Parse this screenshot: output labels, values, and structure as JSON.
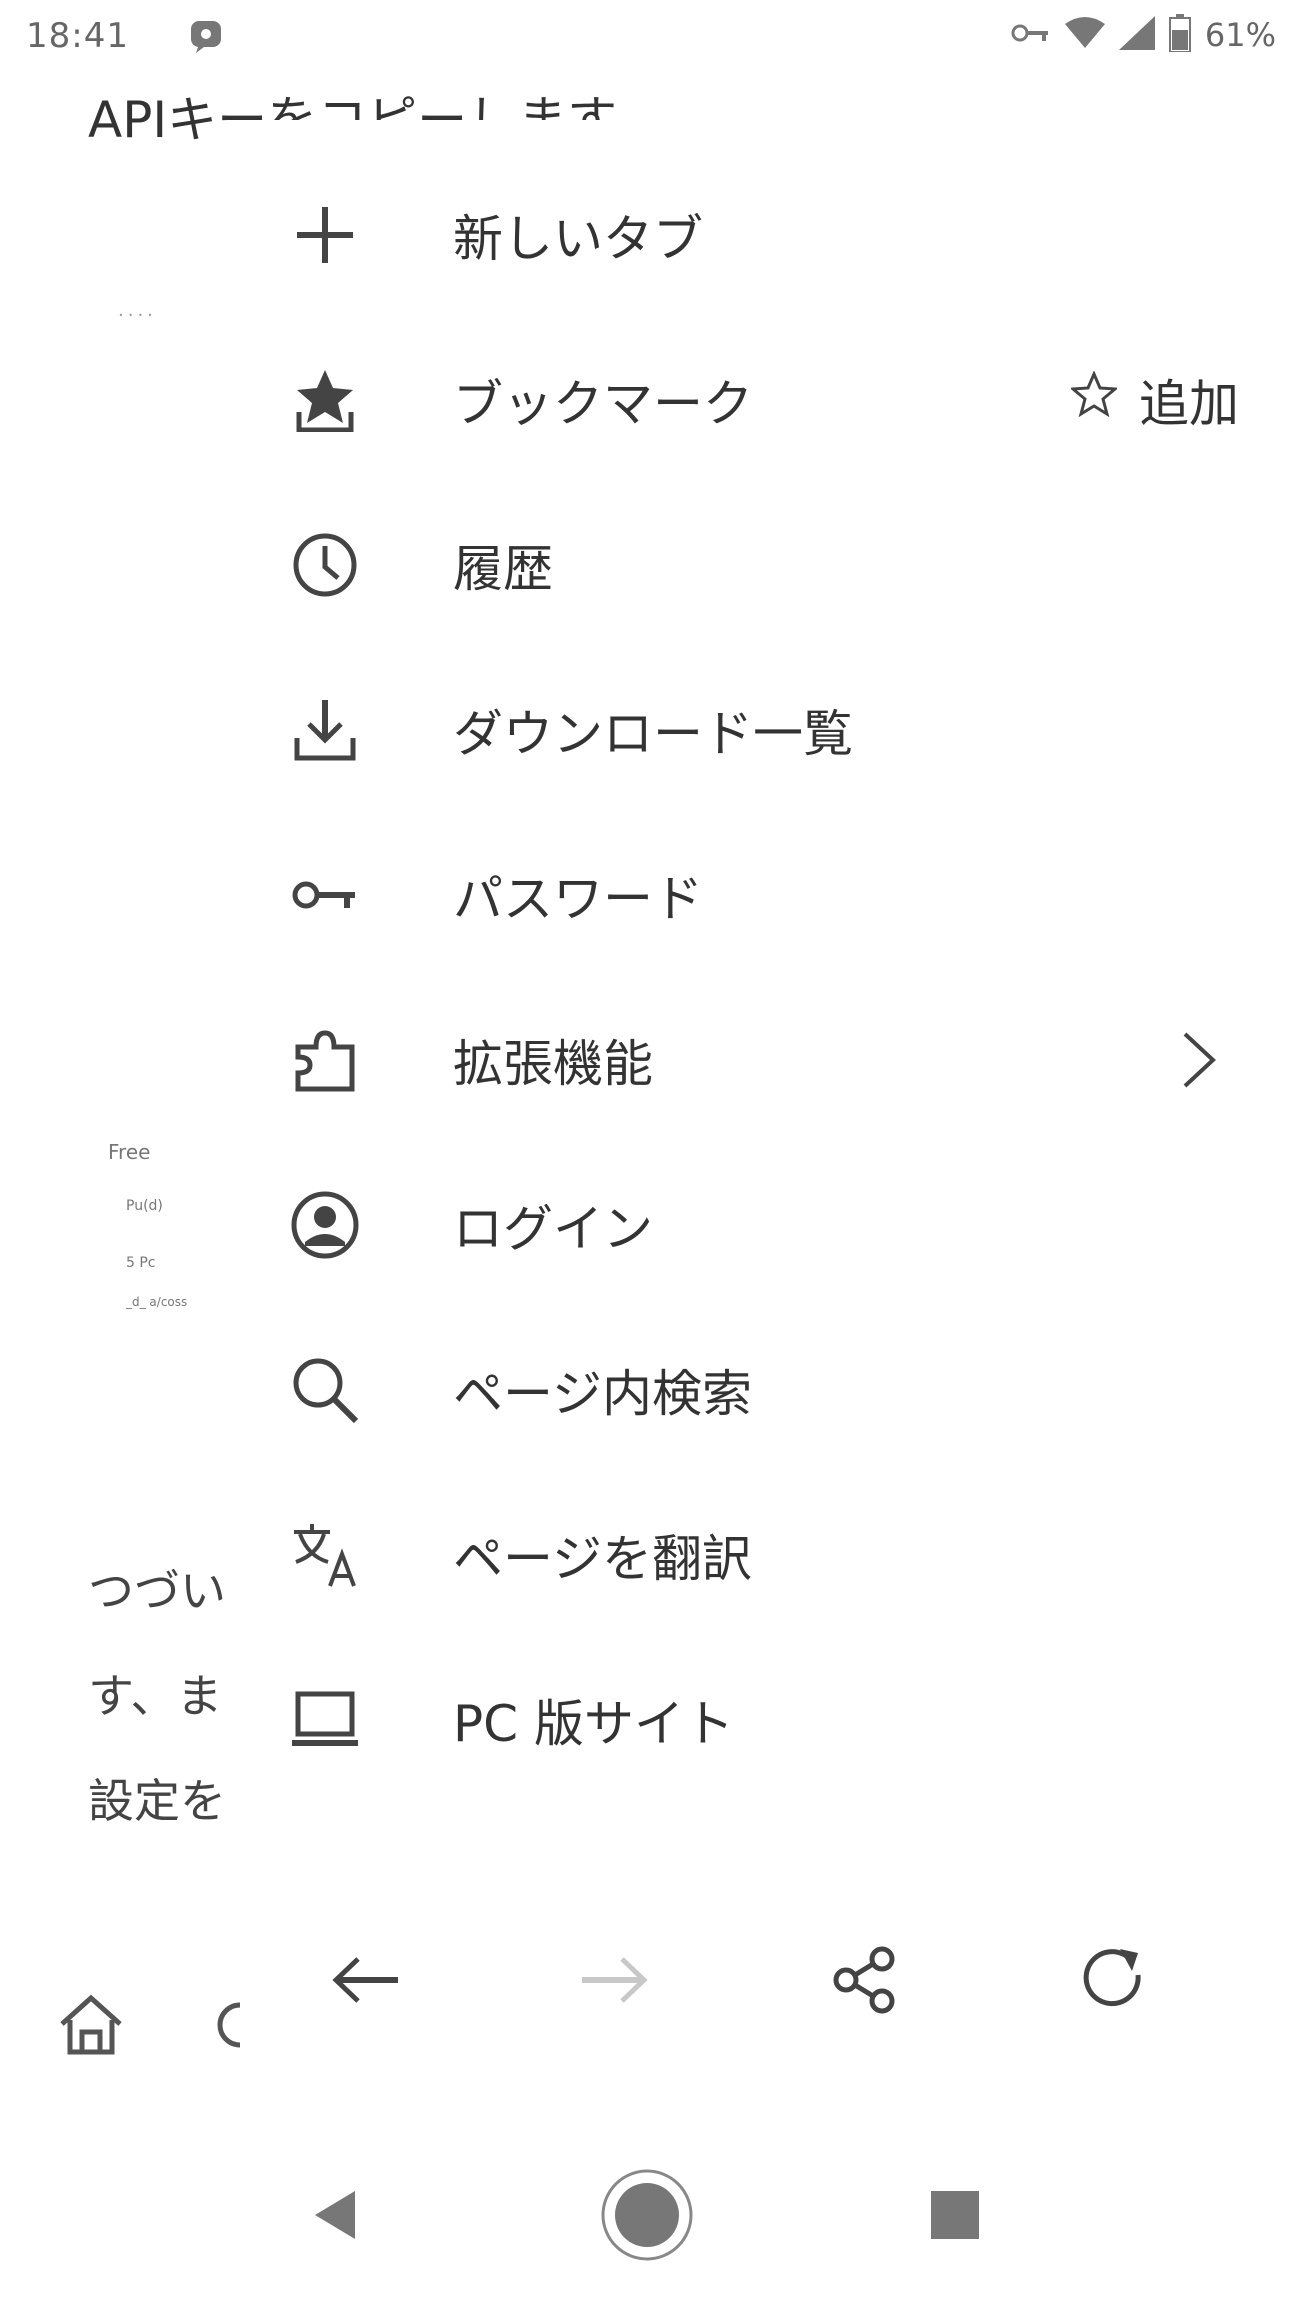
{
  "status_bar": {
    "time": "18:41",
    "battery_text": "61%",
    "icons": [
      "notification-icon",
      "vpn-key-icon",
      "wifi-icon",
      "cellular-signal-icon",
      "battery-icon"
    ]
  },
  "background_page": {
    "title": "APIキーをコピーします。",
    "dots": "....",
    "small_1": "Free",
    "small_2": "Pu(d)",
    "small_3": "5 Pc",
    "small_4": "_d_ a/coss",
    "line_1": "つづい",
    "line_2": "す、ま",
    "line_3": "設定を"
  },
  "menu": {
    "items": [
      {
        "label": "新しいタブ",
        "icon": "plus-icon"
      },
      {
        "label": "ブックマーク",
        "icon": "bookmark-star-icon",
        "extra": "追加",
        "extra_icon": "star-outline-icon"
      },
      {
        "label": "履歴",
        "icon": "clock-icon"
      },
      {
        "label": "ダウンロード一覧",
        "icon": "download-icon"
      },
      {
        "label": "パスワード",
        "icon": "key-icon"
      },
      {
        "label": "拡張機能",
        "icon": "extension-puzzle-icon",
        "has_submenu": true
      },
      {
        "label": "ログイン",
        "icon": "account-circle-icon"
      },
      {
        "label": "ページ内検索",
        "icon": "search-icon"
      },
      {
        "label": "ページを翻訳",
        "icon": "translate-icon"
      },
      {
        "label": "PC 版サイト",
        "icon": "laptop-icon"
      }
    ],
    "actions": [
      "back-arrow-icon",
      "forward-arrow-icon",
      "share-icon",
      "reload-icon"
    ]
  },
  "navbar": {
    "buttons": [
      "back-triangle-icon",
      "home-circle-icon",
      "recents-square-icon"
    ]
  },
  "colors": {
    "icon": "#444444",
    "disabled": "#c8c8c8",
    "text": "#333333",
    "background": "#ffffff"
  }
}
